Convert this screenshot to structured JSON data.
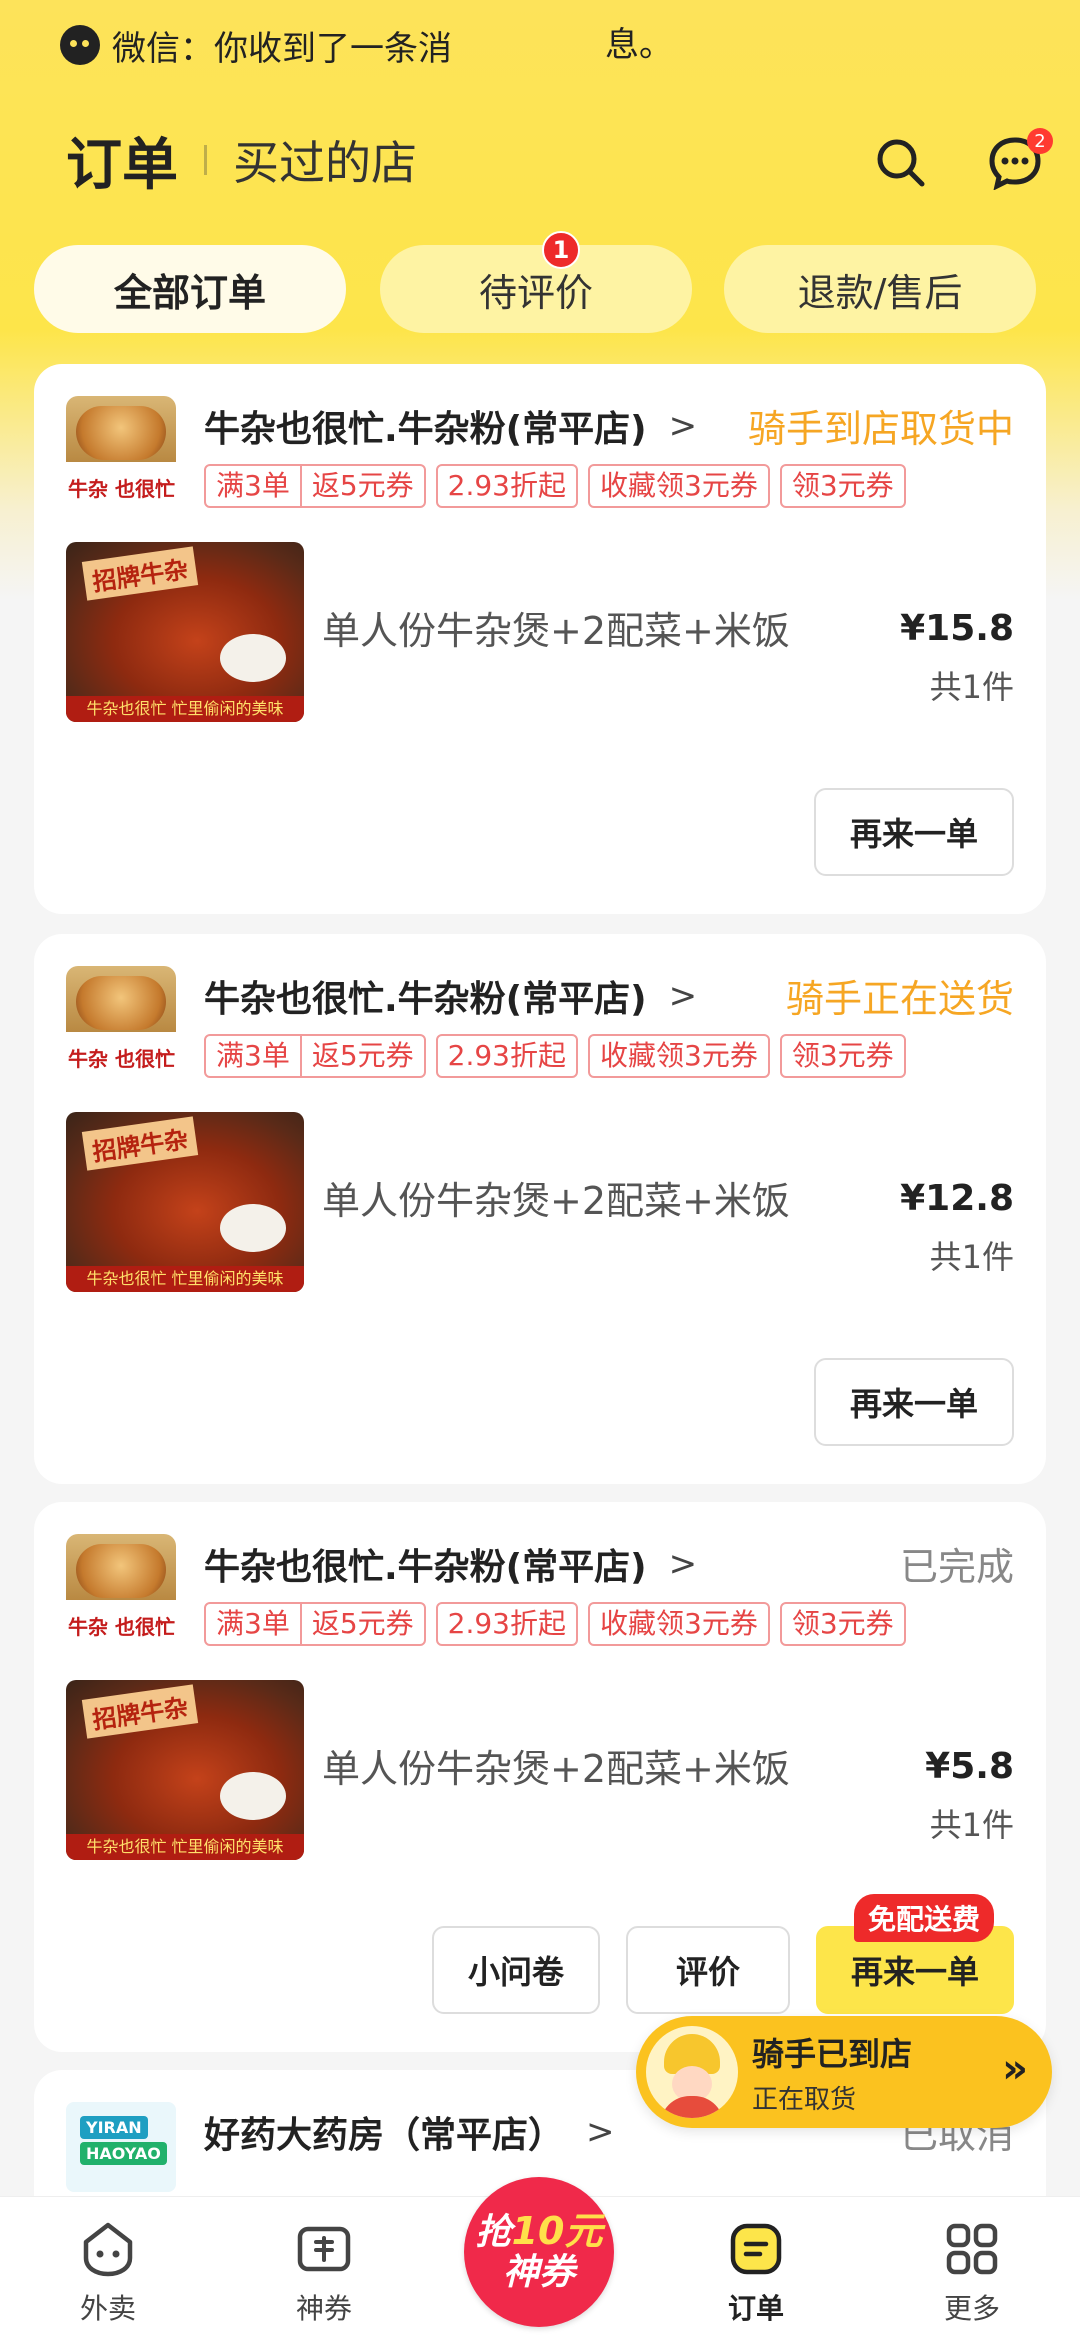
{
  "notification": {
    "text_a": "微信：你收到了一条消",
    "text_b": "息。"
  },
  "header": {
    "title": "订单",
    "subtitle": "买过的店",
    "message_badge": "2"
  },
  "tabs": [
    {
      "label": "全部订单"
    },
    {
      "label": "待评价",
      "badge": "1"
    },
    {
      "label": "退款/售后"
    }
  ],
  "orders": [
    {
      "shop": "牛杂也很忙.牛杂粉(常平店)",
      "status": "骑手到店取货中",
      "logo_text": "牛杂 也很忙",
      "tags": [
        [
          "满3单",
          "返5元券"
        ],
        [
          "2.93折起"
        ],
        [
          "收藏领3元券"
        ],
        [
          "领3元券"
        ]
      ],
      "img_banner": "招牌牛杂",
      "img_strip": "牛杂也很忙 忙里偷闲的美味",
      "item": "单人份牛杂煲+2配菜+米饭",
      "price": "¥15.8",
      "qty": "共1件",
      "button": "再来一单"
    },
    {
      "shop": "牛杂也很忙.牛杂粉(常平店)",
      "status": "骑手正在送货",
      "logo_text": "牛杂 也很忙",
      "tags": [
        [
          "满3单",
          "返5元券"
        ],
        [
          "2.93折起"
        ],
        [
          "收藏领3元券"
        ],
        [
          "领3元券"
        ]
      ],
      "img_banner": "招牌牛杂",
      "img_strip": "牛杂也很忙 忙里偷闲的美味",
      "item": "单人份牛杂煲+2配菜+米饭",
      "price": "¥12.8",
      "qty": "共1件",
      "button": "再来一单"
    },
    {
      "shop": "牛杂也很忙.牛杂粉(常平店)",
      "status": "已完成",
      "logo_text": "牛杂 也很忙",
      "tags": [
        [
          "满3单",
          "返5元券"
        ],
        [
          "2.93折起"
        ],
        [
          "收藏领3元券"
        ],
        [
          "领3元券"
        ]
      ],
      "img_banner": "招牌牛杂",
      "img_strip": "牛杂也很忙 忙里偷闲的美味",
      "item": "单人份牛杂煲+2配菜+米饭",
      "price": "¥5.8",
      "qty": "共1件",
      "button_survey": "小问卷",
      "button_review": "评价",
      "button": "再来一单",
      "free_delivery": "免配送费"
    },
    {
      "shop": "好药大药房（常平店）",
      "status": "已取消",
      "logo_l1": "YIRAN",
      "logo_l2": "HAOYAO"
    }
  ],
  "rider": {
    "title": "骑手已到店",
    "subtitle": "正在取货"
  },
  "bottom_nav": {
    "waimai": "外卖",
    "coupon": "神券",
    "center_a": "抢",
    "center_num": "10元",
    "center_b": "神券",
    "orders": "订单",
    "more": "更多"
  },
  "colors": {
    "brand_yellow": "#fde54a",
    "status_orange": "#f6a623",
    "tag_red": "#e64545",
    "center_red": "#f0294a"
  }
}
